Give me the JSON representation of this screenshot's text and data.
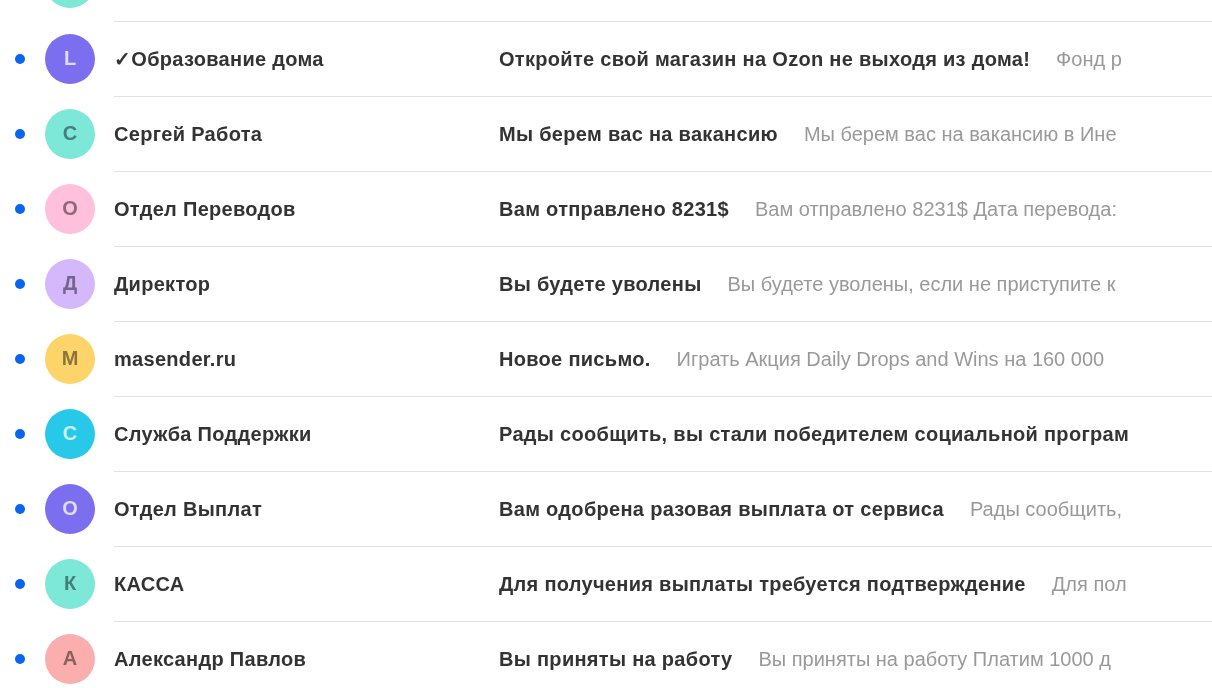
{
  "top_avatar": {
    "color": "#7de8d8"
  },
  "messages": [
    {
      "unread": true,
      "avatar": "L",
      "color": "#7b6ff0",
      "sender": "✓Образование дома",
      "subject": "Откройте свой магазин на Ozon не выходя из дома!",
      "preview": "Фонд р"
    },
    {
      "unread": true,
      "avatar": "С",
      "color": "#7de8d8",
      "sender": "Сергей Работа",
      "subject": "Мы берем вас на вакансию",
      "preview": "Мы берем вас на вакансию в Ине"
    },
    {
      "unread": true,
      "avatar": "О",
      "color": "#ffc0dc",
      "sender": "Отдел Переводов",
      "subject": "Вам отправлено 8231$",
      "preview": "Вам отправлено 8231$ Дата перевода:"
    },
    {
      "unread": true,
      "avatar": "Д",
      "color": "#d5b8fb",
      "sender": "Директор",
      "subject": "Вы будете уволены",
      "preview": "Вы будете уволены, если не приступите к"
    },
    {
      "unread": true,
      "avatar": "М",
      "color": "#fdd469",
      "sender": "masender.ru",
      "subject": "Новое письмо.",
      "preview": "Играть Акция Daily Drops and Wins на 160 000"
    },
    {
      "unread": true,
      "avatar": "С",
      "color": "#28c8e8",
      "sender": "Служба Поддержки",
      "subject": "Рады сообщить, вы стали победителем социальной програм"
    },
    {
      "unread": true,
      "avatar": "О",
      "color": "#7b6ff0",
      "sender": "Отдел Выплат",
      "subject": "Вам одобрена разовая выплата от сервиса",
      "preview": "Рады сообщить,"
    },
    {
      "unread": true,
      "avatar": "К",
      "color": "#7de8d8",
      "sender": "КАССА",
      "subject": "Для получения выплаты требуется подтверждение",
      "preview": "Для пол"
    },
    {
      "unread": true,
      "avatar": "А",
      "color": "#fbaeae",
      "sender": "Александр Павлов",
      "subject": "Вы приняты на работу",
      "preview": "Вы приняты на работу Платим 1000 д"
    }
  ]
}
